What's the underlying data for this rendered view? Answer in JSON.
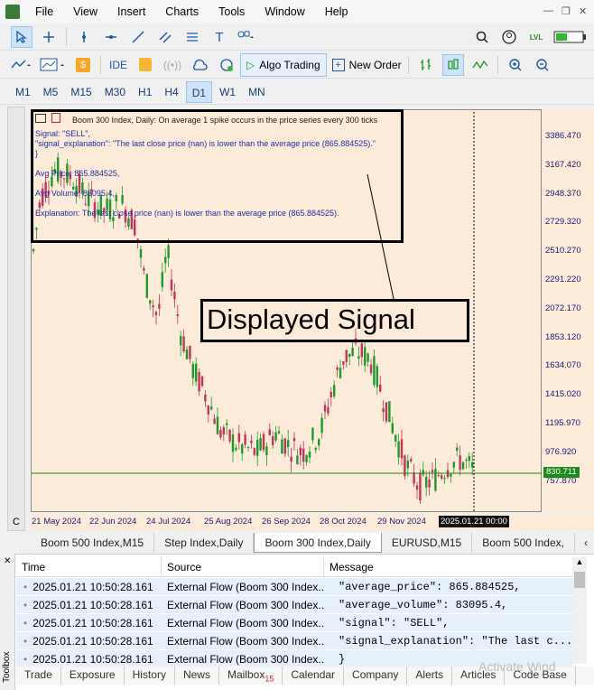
{
  "menu": [
    "File",
    "View",
    "Insert",
    "Charts",
    "Tools",
    "Window",
    "Help"
  ],
  "toolbar2": {
    "ide": "IDE",
    "algo_trading": "Algo Trading",
    "new_order": "New Order"
  },
  "timeframes": [
    "M1",
    "M5",
    "M15",
    "M30",
    "H1",
    "H4",
    "D1",
    "W1",
    "MN"
  ],
  "active_timeframe": "D1",
  "chart": {
    "header": "Boom 300 Index, Daily:  On average 1 spike occurs in the price series every 300 ticks",
    "signal_line": "Signal: \"SELL\",",
    "signal_expl_line": "  \"signal_explanation\": \"The last close price (nan) is lower than the average price (865.884525).\"",
    "brace": "}",
    "avg_price": "Avg Price: 865.884525,",
    "avg_volume": "Avg Volume: 83095.4,",
    "explanation": "Explanation: The last close price (nan) is lower than the average price (865.884525).",
    "callout": "Displayed Signal",
    "current_price": "830.711",
    "current_time": "2025.01.21 00:00",
    "price_levels": [
      "3386.470",
      "3167.420",
      "2948.370",
      "2729.320",
      "2510.270",
      "2291.220",
      "2072.170",
      "1853.120",
      "1634.070",
      "1415.020",
      "1195.970",
      "976.920",
      "757.870"
    ],
    "time_labels": [
      "21 May 2024",
      "22 Jun 2024",
      "24 Jul 2024",
      "25 Aug 2024",
      "26 Sep 2024",
      "28 Oct 2024",
      "29 Nov 2024"
    ]
  },
  "chart_tabs": [
    "Boom 500 Index,M15",
    "Step Index,Daily",
    "Boom 300 Index,Daily",
    "EURUSD,M15",
    "Boom 500 Index,"
  ],
  "active_chart_tab": "Boom 300 Index,Daily",
  "log": {
    "columns": [
      "Time",
      "Source",
      "Message"
    ],
    "rows": [
      {
        "time": "2025.01.21 10:50:28.161",
        "source": "External Flow (Boom 300 Index...",
        "message": "\"average_price\": 865.884525,"
      },
      {
        "time": "2025.01.21 10:50:28.161",
        "source": "External Flow (Boom 300 Index...",
        "message": "\"average_volume\": 83095.4,"
      },
      {
        "time": "2025.01.21 10:50:28.161",
        "source": "External Flow (Boom 300 Index...",
        "message": "\"signal\": \"SELL\","
      },
      {
        "time": "2025.01.21 10:50:28.161",
        "source": "External Flow (Boom 300 Index...",
        "message": "\"signal_explanation\": \"The last c..."
      },
      {
        "time": "2025.01.21 10:50:28.161",
        "source": "External Flow (Boom 300 Index...",
        "message": "}"
      }
    ]
  },
  "bottom_tabs": [
    "Trade",
    "Exposure",
    "History",
    "News",
    "Mailbox",
    "Calendar",
    "Company",
    "Alerts",
    "Articles",
    "Code Base"
  ],
  "mailbox_count": "15",
  "toolbox_label": "Toolbox",
  "watermark": "Activate Wind"
}
